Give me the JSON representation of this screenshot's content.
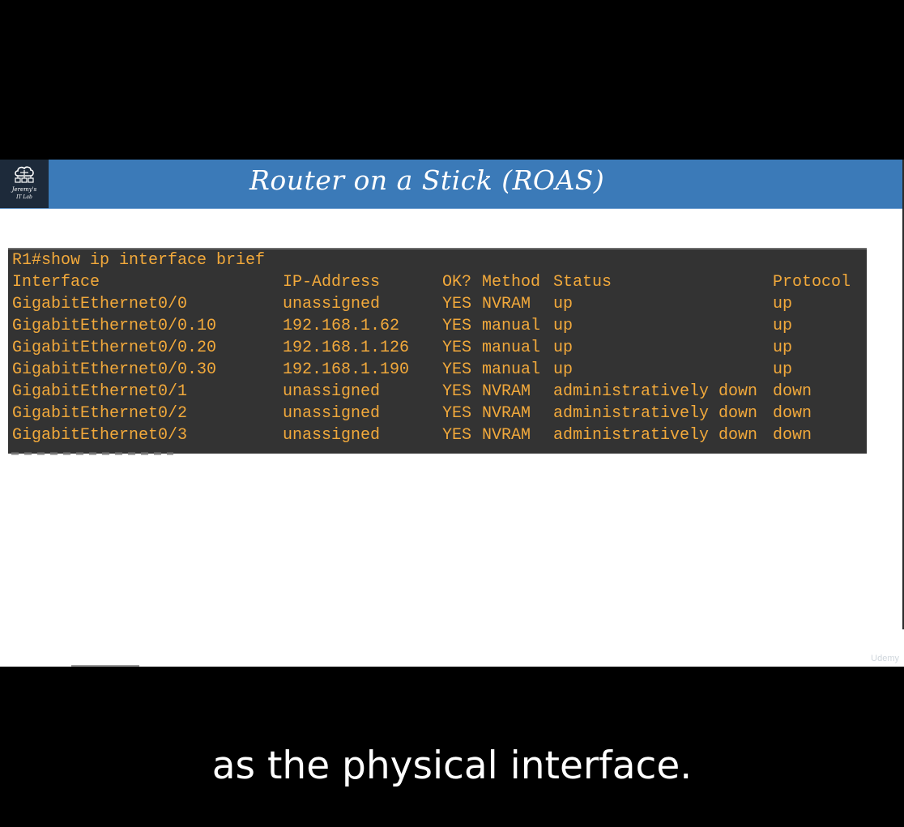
{
  "slide": {
    "title": "Router on a Stick (ROAS)",
    "logo": {
      "icon": "cloud-network-icon",
      "line1": "Jeremy's",
      "line2": "IT Lab"
    },
    "watermark": "Udemy"
  },
  "terminal": {
    "command": "R1#show ip interface brief",
    "columns": {
      "interface": "Interface",
      "ip": "IP-Address",
      "ok": "OK?",
      "method": "Method",
      "status": "Status",
      "protocol": "Protocol"
    },
    "rows": [
      {
        "interface": "GigabitEthernet0/0",
        "ip": "unassigned",
        "ok": "YES",
        "method": "NVRAM",
        "status": "up",
        "protocol": "up"
      },
      {
        "interface": "GigabitEthernet0/0.10",
        "ip": "192.168.1.62",
        "ok": "YES",
        "method": "manual",
        "status": "up",
        "protocol": "up"
      },
      {
        "interface": "GigabitEthernet0/0.20",
        "ip": "192.168.1.126",
        "ok": "YES",
        "method": "manual",
        "status": "up",
        "protocol": "up"
      },
      {
        "interface": "GigabitEthernet0/0.30",
        "ip": "192.168.1.190",
        "ok": "YES",
        "method": "manual",
        "status": "up",
        "protocol": "up"
      },
      {
        "interface": "GigabitEthernet0/1",
        "ip": "unassigned",
        "ok": "YES",
        "method": "NVRAM",
        "status": "administratively down",
        "protocol": "down"
      },
      {
        "interface": "GigabitEthernet0/2",
        "ip": "unassigned",
        "ok": "YES",
        "method": "NVRAM",
        "status": "administratively down",
        "protocol": "down"
      },
      {
        "interface": "GigabitEthernet0/3",
        "ip": "unassigned",
        "ok": "YES",
        "method": "NVRAM",
        "status": "administratively down",
        "protocol": "down"
      }
    ]
  },
  "caption": "as the physical interface.",
  "colors": {
    "background": "#000000",
    "header": "#3b7ab8",
    "terminal_bg": "#333333",
    "terminal_text": "#f2a93b",
    "caption_text": "#ffffff"
  }
}
